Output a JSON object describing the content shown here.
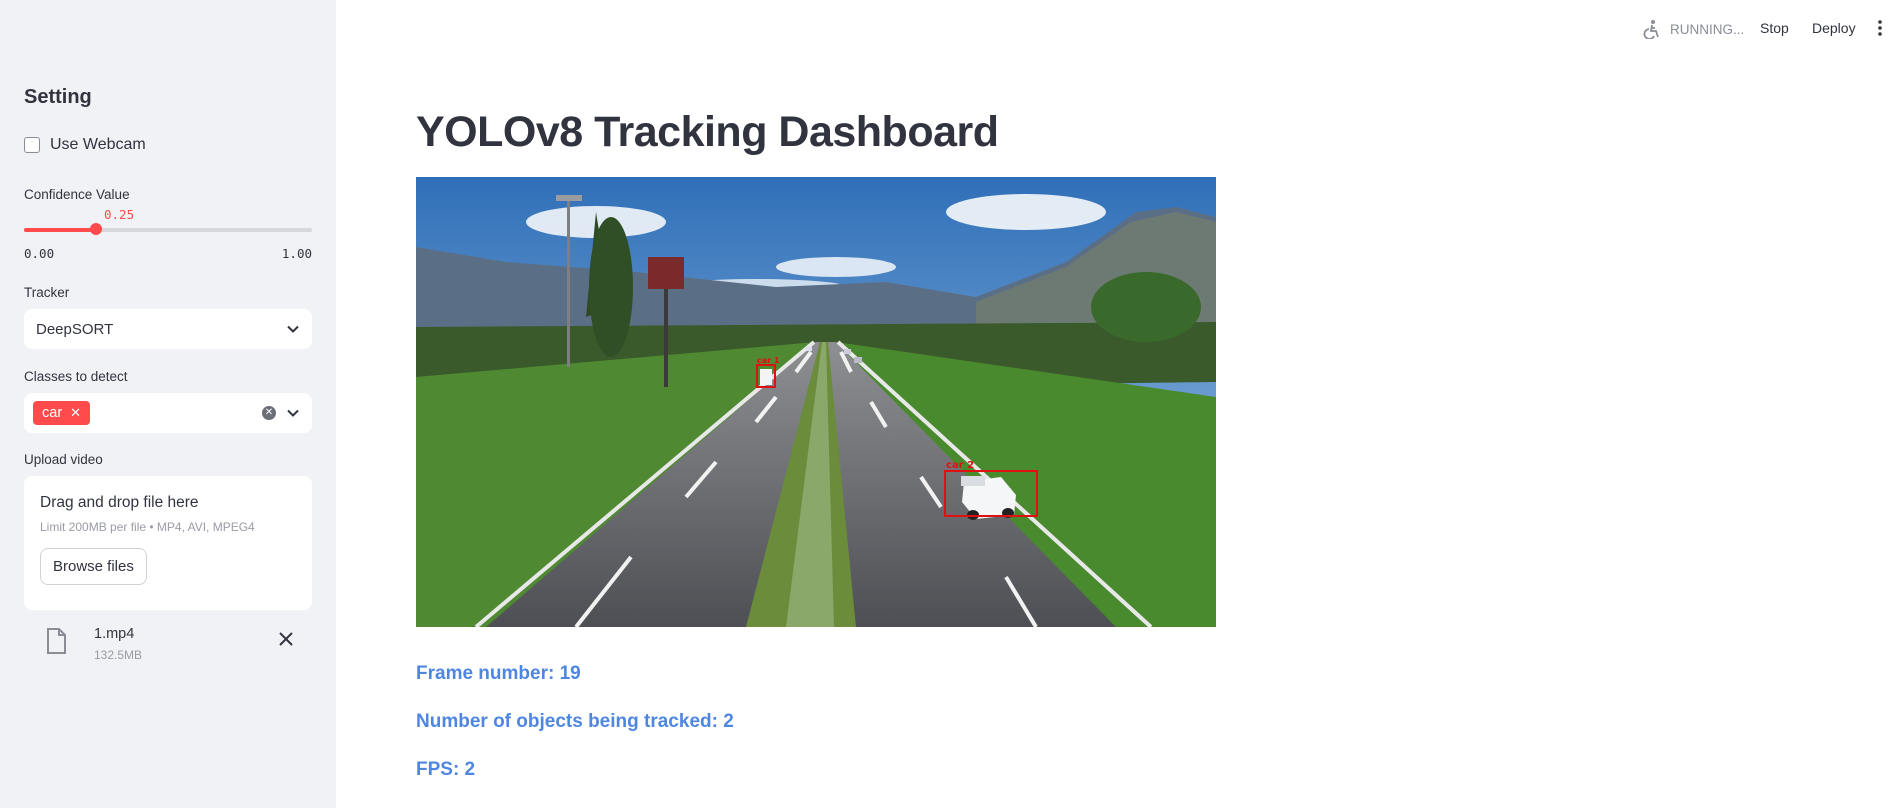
{
  "topbar": {
    "status": "RUNNING...",
    "stop_label": "Stop",
    "deploy_label": "Deploy"
  },
  "sidebar": {
    "title": "Setting",
    "use_webcam": {
      "label": "Use Webcam",
      "checked": false
    },
    "confidence": {
      "label": "Confidence Value",
      "value": "0.25",
      "min": "0.00",
      "max": "1.00",
      "fraction": 0.25
    },
    "tracker": {
      "label": "Tracker",
      "selected": "DeepSORT"
    },
    "classes": {
      "label": "Classes to detect",
      "tags": [
        "car"
      ]
    },
    "upload": {
      "label": "Upload video",
      "drop_text": "Drag and drop file here",
      "limit_text": "Limit 200MB per file • MP4, AVI, MPEG4",
      "browse_label": "Browse files",
      "file_name": "1.mp4",
      "file_size": "132.5MB"
    }
  },
  "main": {
    "title": "YOLOv8 Tracking Dashboard",
    "video": {
      "detections": [
        {
          "label": "car 2"
        },
        {
          "label": "car 1"
        }
      ]
    },
    "frame_number": "Frame number: 19",
    "objects_tracked": "Number of objects being tracked: 2",
    "fps": "FPS: 2"
  },
  "colors": {
    "accent": "#ff4b4b",
    "stat_text": "#4e86e0",
    "sidebar_bg": "#f0f2f6",
    "bbox": "#e01010"
  }
}
